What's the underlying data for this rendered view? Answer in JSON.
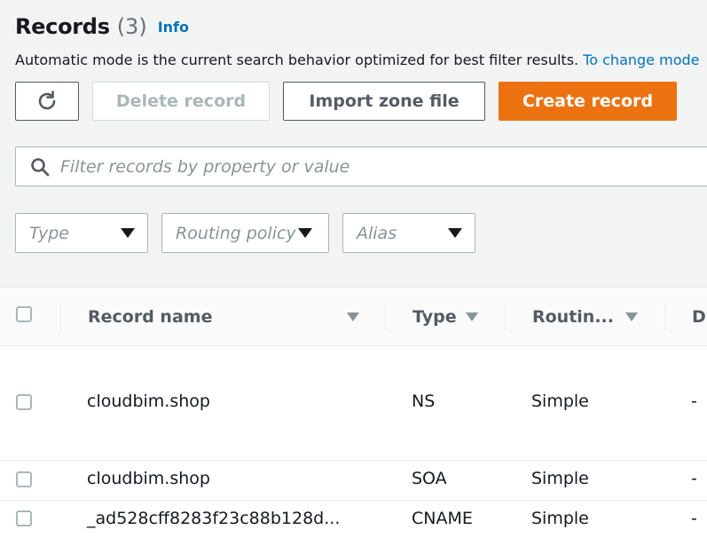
{
  "header": {
    "title": "Records",
    "count": "(3)",
    "info_label": "Info"
  },
  "description": {
    "text": "Automatic mode is the current search behavior optimized for best filter results. ",
    "link": "To change mode"
  },
  "toolbar": {
    "delete_label": "Delete record",
    "import_label": "Import zone file",
    "create_label": "Create record"
  },
  "search": {
    "placeholder": "Filter records by property or value"
  },
  "filters": {
    "type": "Type",
    "routing_policy": "Routing policy",
    "alias": "Alias"
  },
  "table": {
    "columns": {
      "record_name": "Record name",
      "type": "Type",
      "routing": "Routin...",
      "next": "Di"
    },
    "rows": [
      {
        "name": "cloudbim.shop",
        "type": "NS",
        "routing": "Simple",
        "extra": "-"
      },
      {
        "name": "cloudbim.shop",
        "type": "SOA",
        "routing": "Simple",
        "extra": "-"
      },
      {
        "name": "_ad528cff8283f23c88b128d...",
        "type": "CNAME",
        "routing": "Simple",
        "extra": "-"
      }
    ]
  },
  "colors": {
    "primary": "#ec7211",
    "link": "#0073bb"
  }
}
